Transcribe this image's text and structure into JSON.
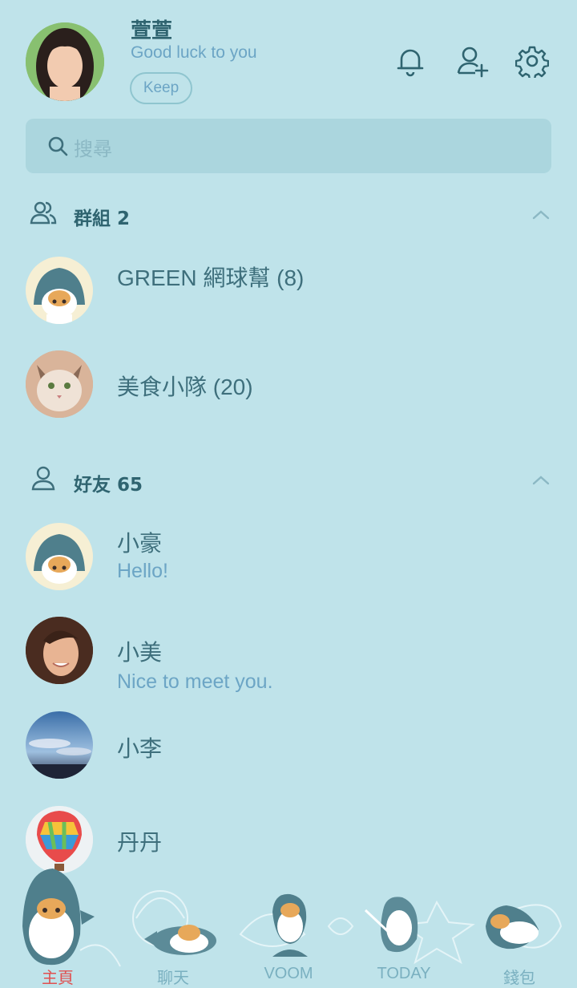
{
  "profile": {
    "name": "萱萱",
    "status": "Good luck to you",
    "keep_label": "Keep"
  },
  "search": {
    "placeholder": "搜尋"
  },
  "groups": {
    "title": "群組 2",
    "items": [
      {
        "name": "GREEN 網球幫 (8)"
      },
      {
        "name": "美食小隊 (20)"
      }
    ]
  },
  "friends": {
    "title": "好友 65",
    "items": [
      {
        "name": "小豪",
        "status": "Hello!"
      },
      {
        "name": "小美",
        "status": "Nice to meet you."
      },
      {
        "name": "小李",
        "status": ""
      },
      {
        "name": "丹丹",
        "status": ""
      }
    ]
  },
  "nav": {
    "items": [
      {
        "label": "主頁",
        "active": true
      },
      {
        "label": "聊天"
      },
      {
        "label": "VOOM"
      },
      {
        "label": "TODAY"
      },
      {
        "label": "錢包"
      }
    ]
  },
  "colors": {
    "background": "#bfe3ea",
    "accent": "#6ca5c5",
    "active_tab": "#e05050"
  },
  "icons": [
    "bell-icon",
    "add-friend-icon",
    "gear-icon",
    "search-icon",
    "group-icon",
    "friend-icon",
    "chevron-up-icon"
  ]
}
